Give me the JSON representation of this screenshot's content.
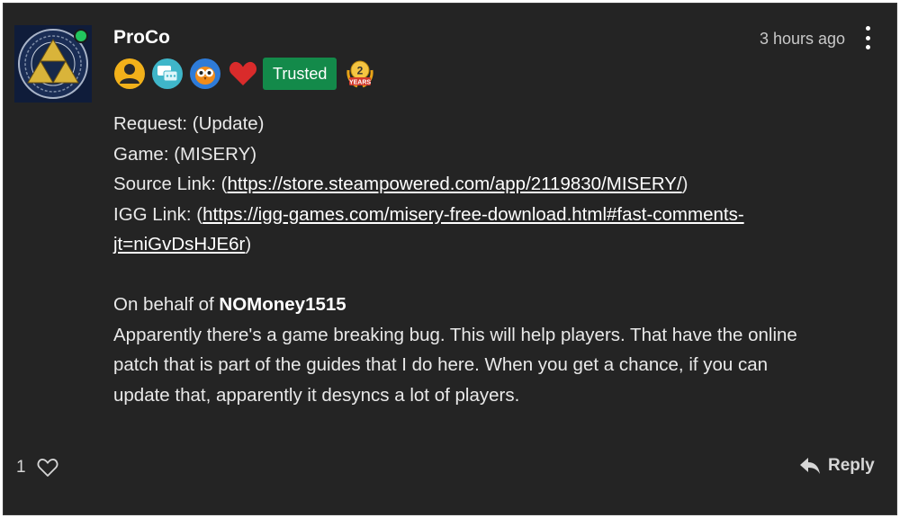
{
  "comment": {
    "author": "ProCo",
    "timestamp": "3 hours ago",
    "badges": [
      "user-badge-icon",
      "chat-badge-icon",
      "owl-badge-icon",
      "heart-badge-icon",
      "two-years-badge-icon"
    ],
    "trusted_label": "Trusted",
    "years_badge": {
      "number": "2",
      "label": "YEARS"
    },
    "body": {
      "request_line": "Request: (Update)",
      "game_line": "Game: (MISERY)",
      "source_prefix": "Source Link: (",
      "source_url": "https://store.steampowered.com/app/2119830/MISERY/",
      "source_suffix": ")",
      "igg_prefix": "IGG Link: (",
      "igg_url_line1": "https://igg-games.com/misery-free-download.html#fast-comments-",
      "igg_url_line2": "jt=niGvDsHJE6r",
      "igg_suffix": ")",
      "behalf_prefix": "On behalf of ",
      "behalf_user": "NOMoney1515",
      "message_line1": "Apparently there's a game breaking bug. This will help players. That have the online",
      "message_line2": "patch that is part of the guides that I do here. When you get a chance, if you can",
      "message_line3": "update that, apparently it desyncs a lot of players."
    },
    "like_count": "1",
    "reply_label": "Reply"
  },
  "colors": {
    "card_bg": "#242424",
    "trusted_bg": "#138a4a",
    "online": "#22c55e",
    "heart": "#d92b2b",
    "badge_gold": "#f2b11a"
  }
}
